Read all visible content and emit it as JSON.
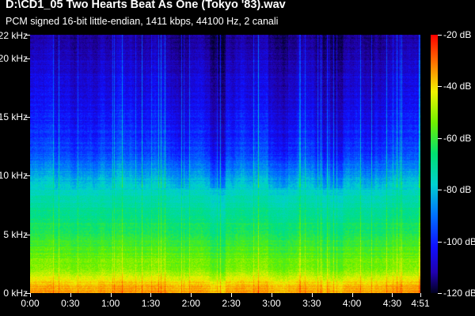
{
  "window": {
    "title": "D:\\CD1_05 Two Hearts Beat As One (Tokyo '83).wav",
    "subtitle": "PCM signed 16-bit little-endian, 1411 kbps, 44100 Hz, 2 canali"
  },
  "chart_data": {
    "type": "heatmap",
    "title": "D:\\CD1_05 Two Hearts Beat As One (Tokyo '83).wav",
    "subtitle": "PCM signed 16-bit little-endian, 1411 kbps, 44100 Hz, 2 canali",
    "x_axis": {
      "unit": "time (m:ss)",
      "range": [
        0,
        291
      ],
      "ticks": [
        {
          "value": 0,
          "label": "0:00"
        },
        {
          "value": 30,
          "label": "0:30"
        },
        {
          "value": 60,
          "label": "1:00"
        },
        {
          "value": 90,
          "label": "1:30"
        },
        {
          "value": 120,
          "label": "2:00"
        },
        {
          "value": 150,
          "label": "2:30"
        },
        {
          "value": 180,
          "label": "3:00"
        },
        {
          "value": 210,
          "label": "3:30"
        },
        {
          "value": 240,
          "label": "4:00"
        },
        {
          "value": 270,
          "label": "4:30"
        },
        {
          "value": 291,
          "label": "4:51"
        }
      ]
    },
    "y_axis": {
      "unit": "kHz",
      "range": [
        0,
        22
      ],
      "ticks": [
        {
          "value": 0,
          "label": "0 kHz"
        },
        {
          "value": 5,
          "label": "5 kHz"
        },
        {
          "value": 10,
          "label": "10 kHz"
        },
        {
          "value": 15,
          "label": "15 kHz"
        },
        {
          "value": 20,
          "label": "20 kHz"
        },
        {
          "value": 22,
          "label": "22 kHz"
        }
      ]
    },
    "colorbar": {
      "range_db": [
        -120,
        -20
      ],
      "ticks": [
        {
          "value": -20,
          "label": "-20 dB"
        },
        {
          "value": -40,
          "label": "-40 dB"
        },
        {
          "value": -60,
          "label": "-60 dB"
        },
        {
          "value": -80,
          "label": "-80 dB"
        },
        {
          "value": -100,
          "label": "-100 dB"
        },
        {
          "value": -120,
          "label": "-120 dB"
        }
      ],
      "colors": [
        "#ff0000",
        "#ff8000",
        "#f0f000",
        "#60f000",
        "#00e080",
        "#00d0d0",
        "#0070ff",
        "#1010ff",
        "#2000a0",
        "#000020"
      ]
    },
    "approx_level_by_frequency": [
      {
        "khz": 0.5,
        "db": -35
      },
      {
        "khz": 2,
        "db": -50
      },
      {
        "khz": 5,
        "db": -60
      },
      {
        "khz": 8,
        "db": -70
      },
      {
        "khz": 9.5,
        "db": -78
      },
      {
        "khz": 12,
        "db": -92
      },
      {
        "khz": 16,
        "db": -100
      },
      {
        "khz": 20,
        "db": -105
      },
      {
        "khz": 22,
        "db": -110
      }
    ]
  }
}
